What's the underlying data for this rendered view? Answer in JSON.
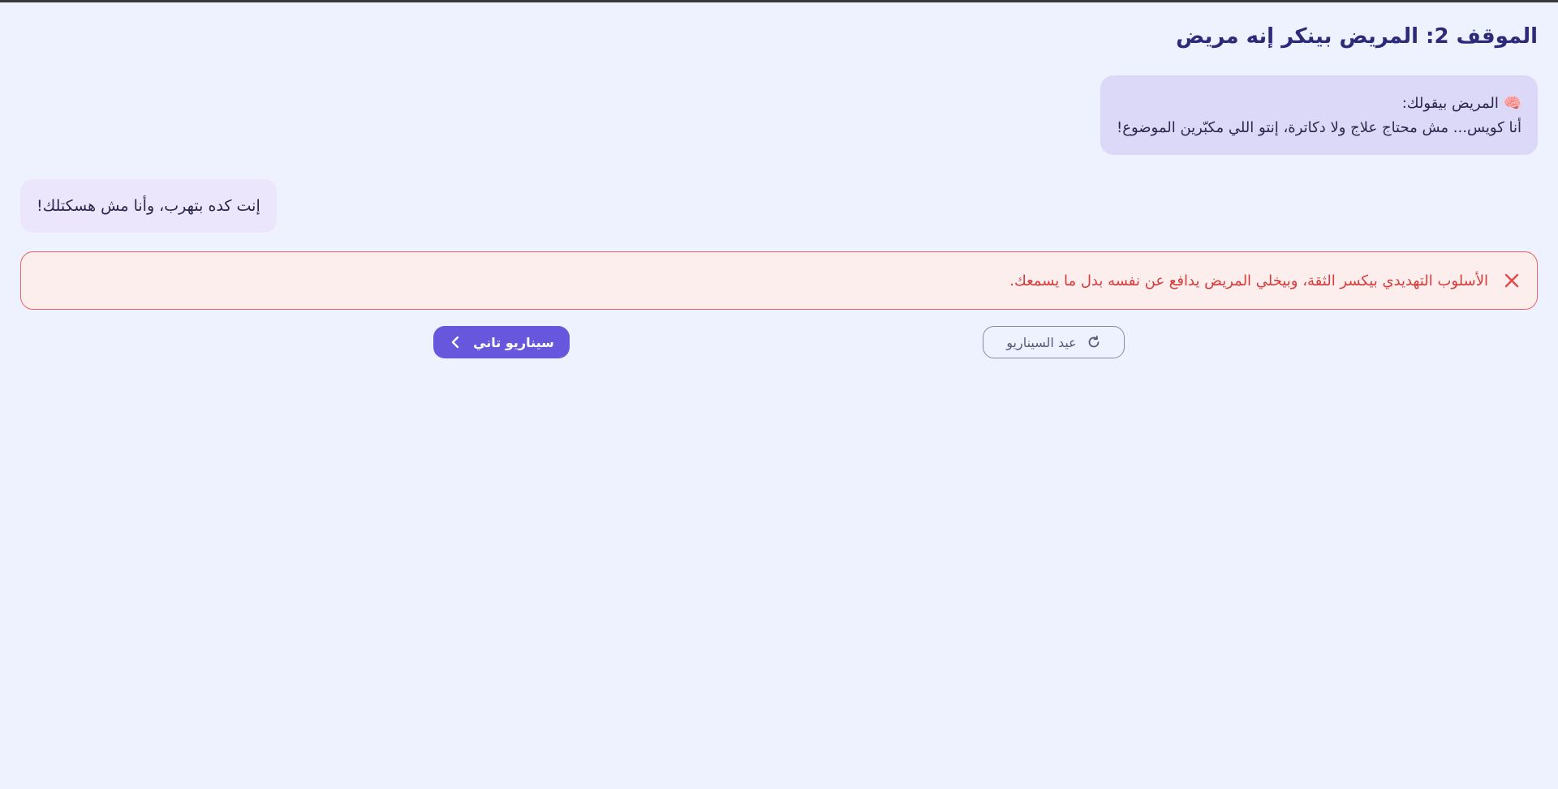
{
  "scenario": {
    "title": "الموقف 2: المريض بينكر إنه مريض"
  },
  "patient_message": {
    "header": "🧠 المريض بيقولك:",
    "text": "أنا كويس... مش محتاج علاج ولا دكاترة، إنتو اللي مكبّرين الموضوع!"
  },
  "user_reply": {
    "text": "إنت كده بتهرب، وأنا مش هسكتلك!"
  },
  "feedback": {
    "icon": "close-icon",
    "text": "الأسلوب التهديدي بيكسر الثقة، وبيخلي المريض يدافع عن نفسه بدل ما يسمعك.",
    "color": "#d83a3a"
  },
  "actions": {
    "retry_label": "عيد السيناريو",
    "retry_icon": "refresh-icon",
    "next_label": "سيناريو تاني",
    "next_icon": "chevron-left-icon"
  },
  "colors": {
    "accent": "#6757dc",
    "background": "#eef2ff",
    "error": "#ee5f66"
  }
}
